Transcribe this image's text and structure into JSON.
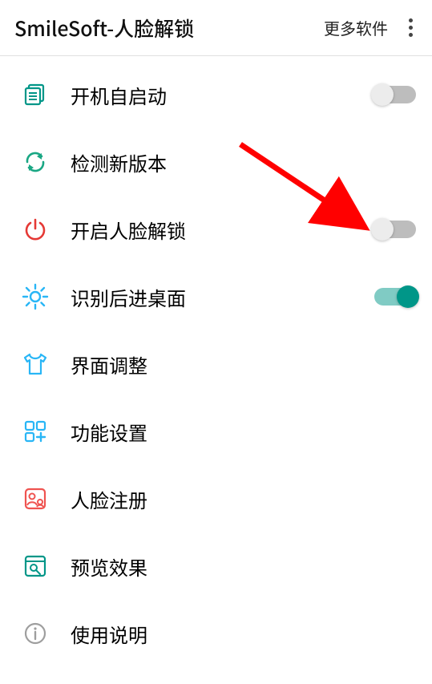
{
  "toolbar": {
    "title": "SmileSoft-人脸解锁",
    "more_label": "更多软件"
  },
  "rows": [
    {
      "key": "autostart",
      "icon": "copy-icon",
      "icon_color": "#229688",
      "label": "开机自启动",
      "toggle": false,
      "toggle_on": false
    },
    {
      "key": "update",
      "icon": "refresh-icon",
      "icon_color": "#229688",
      "label": "检测新版本"
    },
    {
      "key": "enable_face",
      "icon": "power-icon",
      "icon_color": "#e53935",
      "label": "开启人脸解锁",
      "toggle": true,
      "toggle_on": false
    },
    {
      "key": "after_rec",
      "icon": "sun-icon",
      "icon_color": "#29b6f6",
      "label": "识别后进桌面",
      "toggle": true,
      "toggle_on": true
    },
    {
      "key": "ui_adjust",
      "icon": "tshirt-icon",
      "icon_color": "#29b6f6",
      "label": "界面调整"
    },
    {
      "key": "func_settings",
      "icon": "grid-add-icon",
      "icon_color": "#29b6f6",
      "label": "功能设置"
    },
    {
      "key": "face_register",
      "icon": "face-register-icon",
      "icon_color": "#ef5350",
      "label": "人脸注册"
    },
    {
      "key": "preview",
      "icon": "preview-icon",
      "icon_color": "#229688",
      "label": "预览效果"
    },
    {
      "key": "instructions",
      "icon": "info-icon",
      "icon_color": "#9e9e9e",
      "label": "使用说明"
    }
  ],
  "annotation": {
    "arrow_color": "#ff0000"
  }
}
